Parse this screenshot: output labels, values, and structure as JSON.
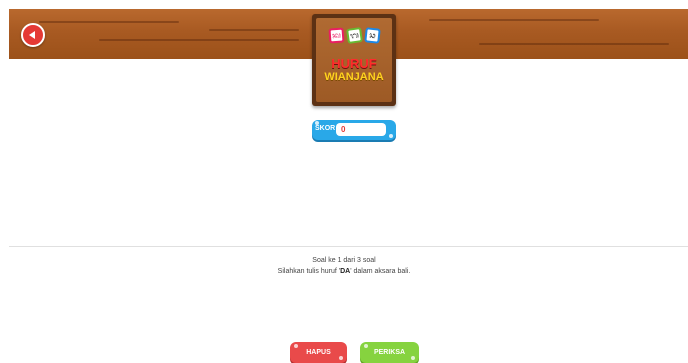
{
  "header": {
    "back_icon": "back-arrow-icon",
    "title_tiles": [
      "ᬓ",
      "ᬕ",
      "ᬘ"
    ],
    "title_line1": "HURUF",
    "title_line2": "WIANJANA"
  },
  "score": {
    "label": "SKOR",
    "value": "0"
  },
  "question": {
    "progress": "Soal ke 1 dari 3 soal",
    "instruction_prefix": "Silahkan tulis huruf '",
    "letter": "DA",
    "instruction_suffix": "' dalam aksara bali."
  },
  "actions": {
    "hapus_label": "HAPUS",
    "periksa_label": "PERIKSA"
  },
  "colors": {
    "wood": "#a85a22",
    "back": "#e53935",
    "score": "#29a8e8",
    "hapus": "#e94a4a",
    "periksa": "#86d33f"
  }
}
